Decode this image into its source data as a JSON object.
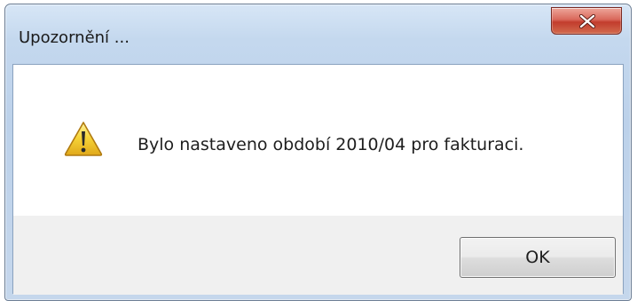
{
  "dialog": {
    "title": "Upozornění ...",
    "message": "Bylo nastaveno období 2010/04 pro fakturaci.",
    "icon": "warning-icon",
    "ok_label": "OK",
    "close_icon": "close-icon"
  },
  "colors": {
    "close_button": "#c94a3b",
    "warning_icon": "#f5c518",
    "window_frame": "#bcd1ea"
  }
}
